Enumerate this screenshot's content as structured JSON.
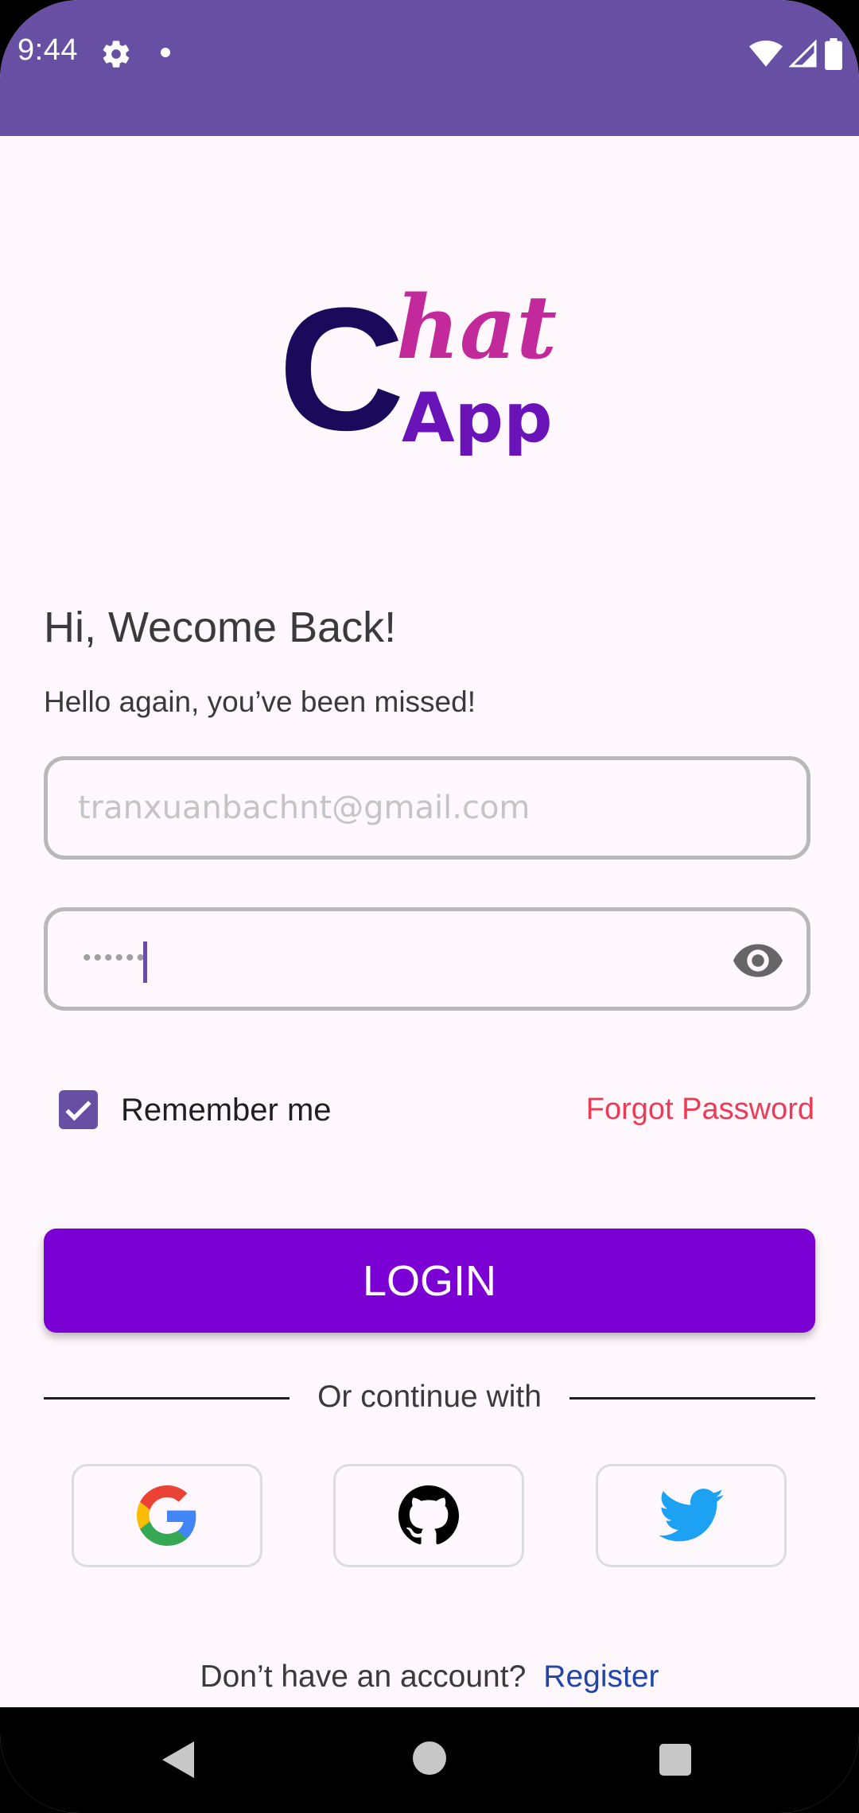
{
  "status_bar": {
    "time": "9:44",
    "color": "#6750a4"
  },
  "logo": {
    "text_c": "C",
    "text_hat": "hat",
    "text_app": "App"
  },
  "heading": "Hi, Wecome Back!",
  "subheading": "Hello again, you’ve been missed!",
  "email_field": {
    "placeholder": "tranxuanbachnt@gmail.com",
    "value": ""
  },
  "password_field": {
    "masked_value": "••••••",
    "toggle_icon": "eye-icon"
  },
  "remember_me": {
    "label": "Remember me",
    "checked": true
  },
  "forgot_password": "Forgot Password",
  "login_button": "LOGIN",
  "divider_text": "Or continue with",
  "social": [
    {
      "name": "google",
      "icon": "google-icon"
    },
    {
      "name": "github",
      "icon": "github-icon"
    },
    {
      "name": "twitter",
      "icon": "twitter-icon"
    }
  ],
  "register": {
    "prompt": "Don’t have an account?",
    "link": "Register"
  },
  "colors": {
    "primary": "#6750a4",
    "login_button": "#7b00d3",
    "forgot_link": "#ee3b55",
    "register_link": "#2146a8",
    "logo_dark": "#1a0a5c",
    "logo_pink": "#c2299a",
    "logo_purple": "#6a13b8"
  }
}
